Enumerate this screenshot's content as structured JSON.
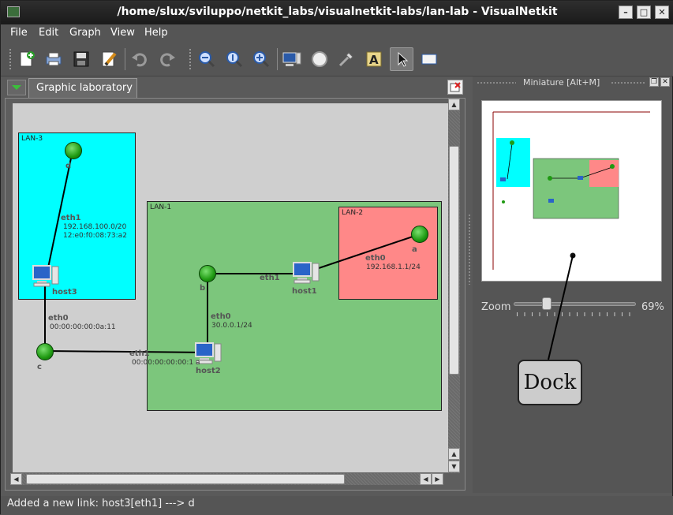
{
  "window": {
    "title": "/home/slux/sviluppo/netkit_labs/visualnetkit-labs/lan-lab - VisualNetkit"
  },
  "menu": [
    "File",
    "Edit",
    "Graph",
    "View",
    "Help"
  ],
  "toolbar": {
    "icons": [
      "new-file-icon",
      "print-icon",
      "save-icon",
      "edit-icon",
      "undo-icon",
      "redo-icon",
      "zoom-out-icon",
      "zoom-reset-icon",
      "zoom-in-icon",
      "add-host-icon",
      "add-collision-domain-icon",
      "add-link-icon",
      "add-label-icon",
      "pointer-icon",
      "select-area-icon"
    ]
  },
  "tab": {
    "label": "Graphic laboratory"
  },
  "graph": {
    "lans": [
      {
        "name": "LAN-3",
        "color": "#00ffff"
      },
      {
        "name": "LAN-1",
        "color": "#7cc67c"
      },
      {
        "name": "LAN-2",
        "color": "#ff8888"
      }
    ],
    "nodes": [
      {
        "name": "d"
      },
      {
        "name": "a"
      },
      {
        "name": "b"
      },
      {
        "name": "c"
      }
    ],
    "hosts": [
      {
        "name": "host3"
      },
      {
        "name": "host1"
      },
      {
        "name": "host2"
      }
    ],
    "interfaces": {
      "host3_eth1": {
        "name": "eth1",
        "ip": "192.168.100.0/20",
        "mac": "12:e0:f0:08:73:a2"
      },
      "host3_eth0": {
        "name": "eth0",
        "mac": "00:00:00:00:0a:11"
      },
      "host1_eth0": {
        "name": "eth0",
        "ip": "192.168.1.1/24"
      },
      "host1_eth1": {
        "name": "eth1"
      },
      "host2_eth0": {
        "name": "eth0",
        "ip": "30.0.0.1/24"
      },
      "host2_eth1": {
        "name": "eth1",
        "mac": "00:00:00:00:00:1 a"
      }
    }
  },
  "dock": {
    "title": "Miniature [Alt+M]",
    "zoom_label": "Zoom",
    "zoom_value": "69%",
    "zoom_fraction": 0.27,
    "callout": "Dock"
  },
  "status": {
    "message": "Added a new link: host3[eth1] ---> d"
  }
}
